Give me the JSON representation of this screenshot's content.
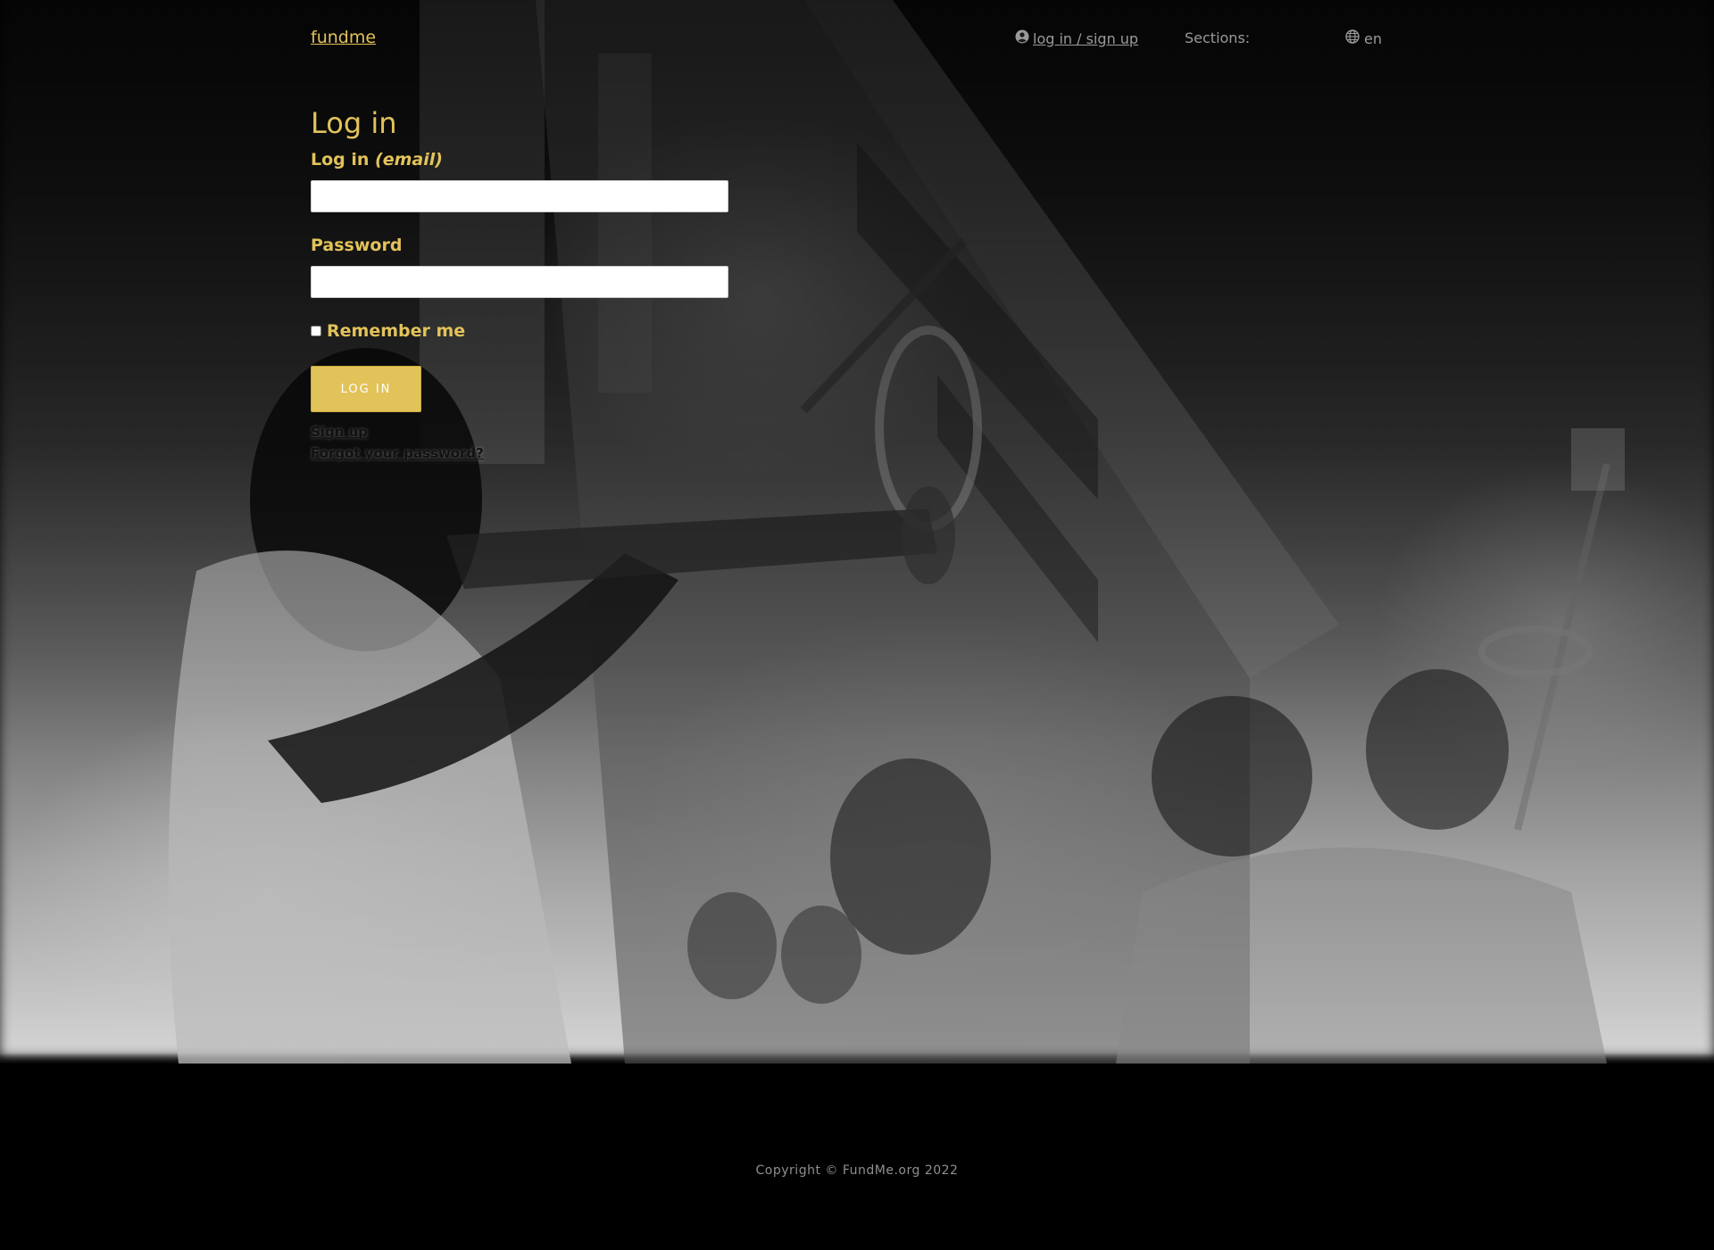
{
  "header": {
    "brand": "fundme",
    "login_signup": " log in / sign up",
    "sections_label": "Sections:",
    "language": "en"
  },
  "form": {
    "title": "Log in",
    "email_label": "Log in ",
    "email_label_em": "(email)",
    "email_value": "",
    "password_label": "Password",
    "password_value": "",
    "remember_label": "Remember me",
    "remember_checked": false,
    "submit_label": "LOG IN"
  },
  "links": {
    "signup": "Sign up",
    "forgot": "Forgot your password?"
  },
  "footer": {
    "copyright": "Copyright © FundMe.org 2022"
  },
  "colors": {
    "accent": "#e2c35a",
    "footer_bg": "#000000",
    "nav_text": "#9a9a9a"
  },
  "icons": {
    "user": "user-circle-icon",
    "language": "globe-icon"
  }
}
